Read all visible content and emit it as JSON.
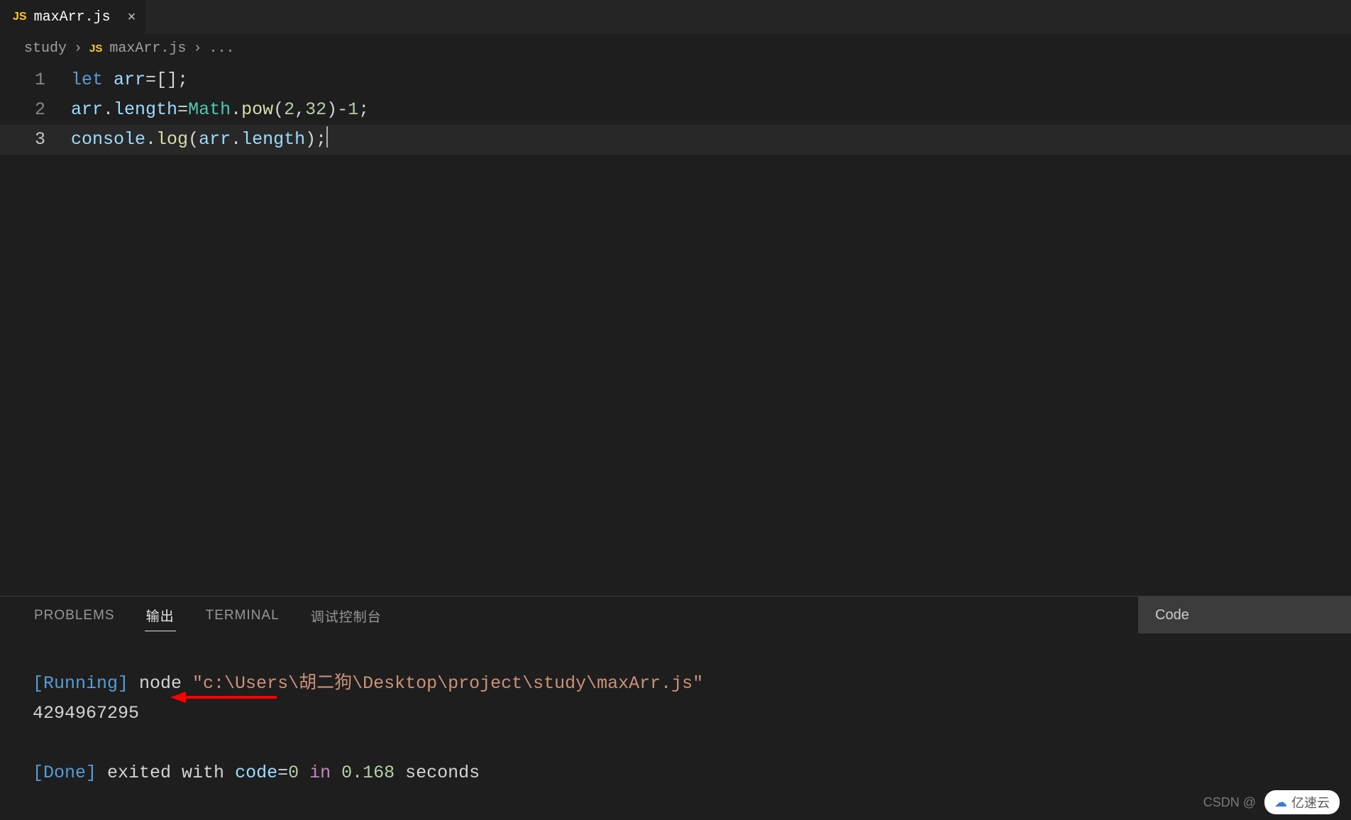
{
  "tab": {
    "icon_label": "JS",
    "filename": "maxArr.js",
    "close_glyph": "×"
  },
  "breadcrumb": {
    "folder": "study",
    "icon_label": "JS",
    "filename": "maxArr.js",
    "trailing": "..."
  },
  "editor": {
    "lines": [
      "1",
      "2",
      "3"
    ],
    "l1": {
      "kw": "let",
      "sp1": " ",
      "id": "arr",
      "eq": "=",
      "br": "[];"
    },
    "l2": {
      "obj1": "arr",
      "dot1": ".",
      "prop1": "length",
      "eq": "=",
      "cls": "Math",
      "dot2": ".",
      "fn": "pow",
      "open": "(",
      "n1": "2",
      "comma": ",",
      "n2": "32",
      "close": ")",
      "minus": "-",
      "n3": "1",
      "semi": ";"
    },
    "l3": {
      "obj": "console",
      "dot1": ".",
      "fn": "log",
      "open": "(",
      "arg_obj": "arr",
      "dot2": ".",
      "arg_prop": "length",
      "close": ");"
    }
  },
  "panel": {
    "tabs": {
      "problems": "PROBLEMS",
      "output": "输出",
      "terminal": "TERMINAL",
      "debug": "调试控制台"
    },
    "selector": "Code"
  },
  "terminal": {
    "run_bracket": "[Running]",
    "run_cmd": " node ",
    "run_path": "\"c:\\Users\\胡二狗\\Desktop\\project\\study\\maxArr.js\"",
    "result": "4294967295",
    "done_bracket": "[Done]",
    "done_t1": " exited with ",
    "done_code_k": "code",
    "done_eq": "=",
    "done_code_v": "0",
    "done_in": " in ",
    "done_time": "0.168",
    "done_sec": " seconds"
  },
  "watermark": {
    "csdn": "CSDN @",
    "badge_text": "亿速云"
  }
}
